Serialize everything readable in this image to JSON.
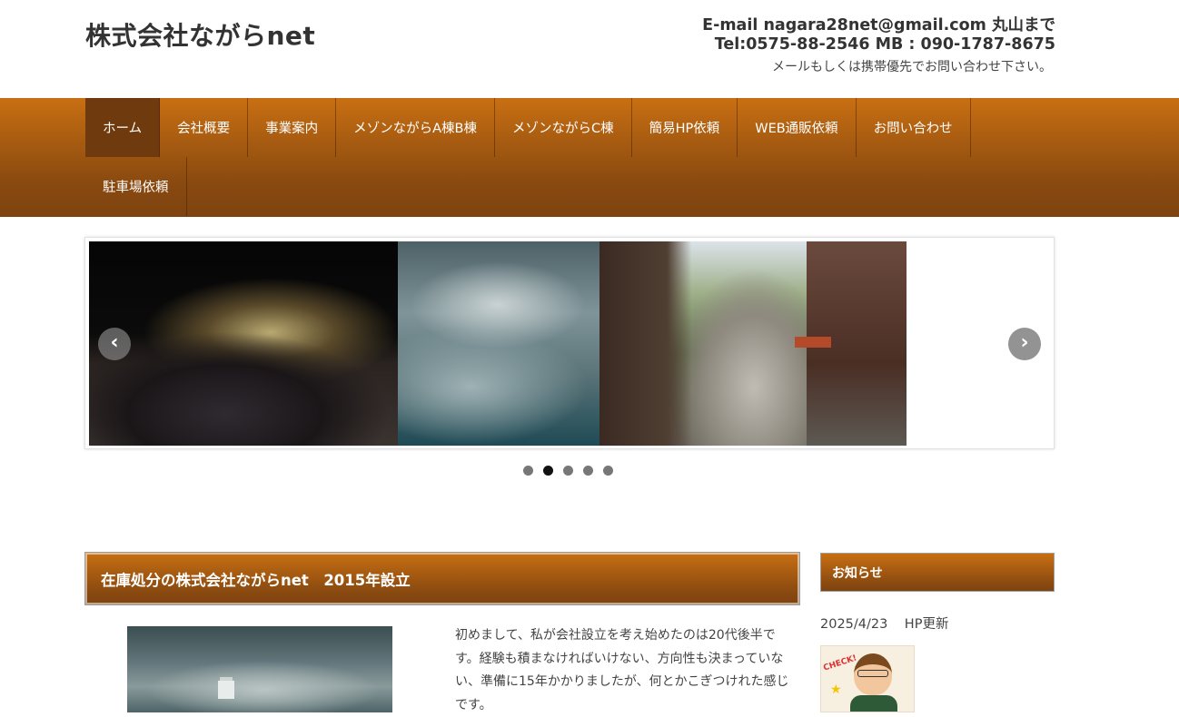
{
  "header": {
    "site_title": "株式会社ながらnet",
    "contact_line1": "E-mail nagara28net@gmail.com 丸山まで",
    "contact_line2": "Tel:0575-88-2546 MB : 090-1787-8675",
    "contact_note": "メールもしくは携帯優先でお問い合わせ下さい。"
  },
  "nav": {
    "row1": [
      "ホーム",
      "会社概要",
      "事業案内",
      "メゾンながらA棟B棟",
      "メゾンながらC棟",
      "簡易HP依頼",
      "WEB通販依頼",
      "お問い合わせ"
    ],
    "row2": [
      "駐車場依頼"
    ],
    "active": "ホーム"
  },
  "slider": {
    "prev_icon": "chevron-left-icon",
    "next_icon": "chevron-right-icon",
    "prev_glyph": "‹",
    "next_glyph": "›",
    "dot_count": 5,
    "active_dot": 2
  },
  "main": {
    "title": "在庫処分の株式会社ながらnet　2015年設立",
    "intro": "初めまして、私が会社設立を考え始めたのは20代後半です。経験も積まなければいけない、方向性も決まっていない、準備に15年かかりましたが、何とかこぎつけれた感じです。"
  },
  "sidebar": {
    "title": "お知らせ",
    "news_date": "2025/4/23",
    "news_text": "HP更新",
    "check_label": "CHECK!"
  },
  "colors": {
    "nav_top": "#c86f12",
    "nav_bottom": "#7e430f",
    "nav_active": "#6f3a0d"
  }
}
